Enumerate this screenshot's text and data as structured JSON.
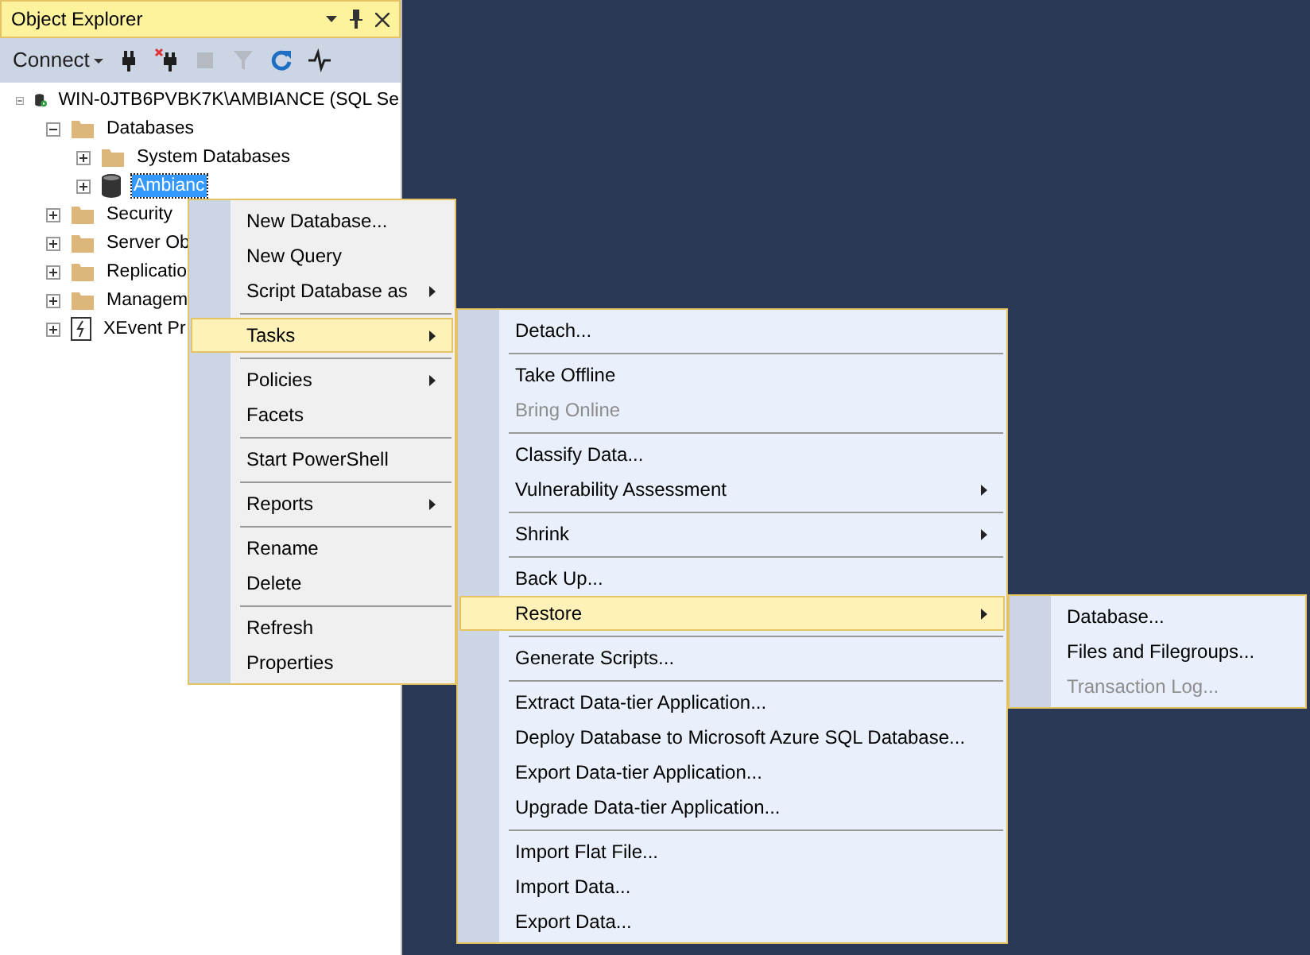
{
  "panel": {
    "title": "Object Explorer",
    "toolbar": {
      "connect": "Connect",
      "tools": [
        {
          "kind": "plug",
          "disabled": false
        },
        {
          "kind": "unplug",
          "disabled": false
        },
        {
          "kind": "stop",
          "disabled": true
        },
        {
          "kind": "filter",
          "disabled": true
        },
        {
          "kind": "refresh",
          "disabled": false
        },
        {
          "kind": "activity",
          "disabled": false
        }
      ]
    }
  },
  "tree": [
    {
      "label": "WIN-0JTB6PVBK7K\\AMBIANCE (SQL Se",
      "kind": "server",
      "expanded": true,
      "selected": false,
      "children": [
        {
          "label": "Databases",
          "kind": "folder",
          "expanded": true,
          "selected": false,
          "children": [
            {
              "label": "System Databases",
              "kind": "folder",
              "expanded": false,
              "selected": false
            },
            {
              "label": "Ambianc",
              "kind": "database",
              "expanded": false,
              "selected": true
            }
          ]
        },
        {
          "label": "Security",
          "kind": "folder",
          "expanded": false,
          "selected": false
        },
        {
          "label": "Server Ob",
          "kind": "folder",
          "expanded": false,
          "selected": false
        },
        {
          "label": "Replicatio",
          "kind": "folder",
          "expanded": false,
          "selected": false
        },
        {
          "label": "Managem",
          "kind": "folder",
          "expanded": false,
          "selected": false
        },
        {
          "label": "XEvent Pr",
          "kind": "xevent",
          "expanded": false,
          "selected": false
        }
      ]
    }
  ],
  "menus": [
    {
      "items": [
        {
          "kind": "item",
          "label": "New Database...",
          "submenu": false,
          "disabled": false,
          "selected": false
        },
        {
          "kind": "item",
          "label": "New Query",
          "submenu": false,
          "disabled": false,
          "selected": false
        },
        {
          "kind": "item",
          "label": "Script Database as",
          "submenu": true,
          "disabled": false,
          "selected": false
        },
        {
          "kind": "separator"
        },
        {
          "kind": "item",
          "label": "Tasks",
          "submenu": true,
          "disabled": false,
          "selected": true
        },
        {
          "kind": "separator"
        },
        {
          "kind": "item",
          "label": "Policies",
          "submenu": true,
          "disabled": false,
          "selected": false
        },
        {
          "kind": "item",
          "label": "Facets",
          "submenu": false,
          "disabled": false,
          "selected": false
        },
        {
          "kind": "separator"
        },
        {
          "kind": "item",
          "label": "Start PowerShell",
          "submenu": false,
          "disabled": false,
          "selected": false
        },
        {
          "kind": "separator"
        },
        {
          "kind": "item",
          "label": "Reports",
          "submenu": true,
          "disabled": false,
          "selected": false
        },
        {
          "kind": "separator"
        },
        {
          "kind": "item",
          "label": "Rename",
          "submenu": false,
          "disabled": false,
          "selected": false
        },
        {
          "kind": "item",
          "label": "Delete",
          "submenu": false,
          "disabled": false,
          "selected": false
        },
        {
          "kind": "separator"
        },
        {
          "kind": "item",
          "label": "Refresh",
          "submenu": false,
          "disabled": false,
          "selected": false
        },
        {
          "kind": "item",
          "label": "Properties",
          "submenu": false,
          "disabled": false,
          "selected": false
        }
      ]
    },
    {
      "items": [
        {
          "kind": "item",
          "label": "Detach...",
          "submenu": false,
          "disabled": false,
          "selected": false
        },
        {
          "kind": "separator"
        },
        {
          "kind": "item",
          "label": "Take Offline",
          "submenu": false,
          "disabled": false,
          "selected": false
        },
        {
          "kind": "item",
          "label": "Bring Online",
          "submenu": false,
          "disabled": true,
          "selected": false
        },
        {
          "kind": "separator"
        },
        {
          "kind": "item",
          "label": "Classify Data...",
          "submenu": false,
          "disabled": false,
          "selected": false
        },
        {
          "kind": "item",
          "label": "Vulnerability Assessment",
          "submenu": true,
          "disabled": false,
          "selected": false
        },
        {
          "kind": "separator"
        },
        {
          "kind": "item",
          "label": "Shrink",
          "submenu": true,
          "disabled": false,
          "selected": false
        },
        {
          "kind": "separator"
        },
        {
          "kind": "item",
          "label": "Back Up...",
          "submenu": false,
          "disabled": false,
          "selected": false
        },
        {
          "kind": "item",
          "label": "Restore",
          "submenu": true,
          "disabled": false,
          "selected": true
        },
        {
          "kind": "separator"
        },
        {
          "kind": "item",
          "label": "Generate Scripts...",
          "submenu": false,
          "disabled": false,
          "selected": false
        },
        {
          "kind": "separator"
        },
        {
          "kind": "item",
          "label": "Extract Data-tier Application...",
          "submenu": false,
          "disabled": false,
          "selected": false
        },
        {
          "kind": "item",
          "label": "Deploy Database to Microsoft Azure SQL Database...",
          "submenu": false,
          "disabled": false,
          "selected": false
        },
        {
          "kind": "item",
          "label": "Export Data-tier Application...",
          "submenu": false,
          "disabled": false,
          "selected": false
        },
        {
          "kind": "item",
          "label": "Upgrade Data-tier Application...",
          "submenu": false,
          "disabled": false,
          "selected": false
        },
        {
          "kind": "separator"
        },
        {
          "kind": "item",
          "label": "Import Flat File...",
          "submenu": false,
          "disabled": false,
          "selected": false
        },
        {
          "kind": "item",
          "label": "Import Data...",
          "submenu": false,
          "disabled": false,
          "selected": false
        },
        {
          "kind": "item",
          "label": "Export Data...",
          "submenu": false,
          "disabled": false,
          "selected": false
        }
      ]
    },
    {
      "items": [
        {
          "kind": "item",
          "label": "Database...",
          "submenu": false,
          "disabled": false,
          "selected": false
        },
        {
          "kind": "item",
          "label": "Files and Filegroups...",
          "submenu": false,
          "disabled": false,
          "selected": false
        },
        {
          "kind": "item",
          "label": "Transaction Log...",
          "submenu": false,
          "disabled": true,
          "selected": false
        }
      ]
    }
  ]
}
